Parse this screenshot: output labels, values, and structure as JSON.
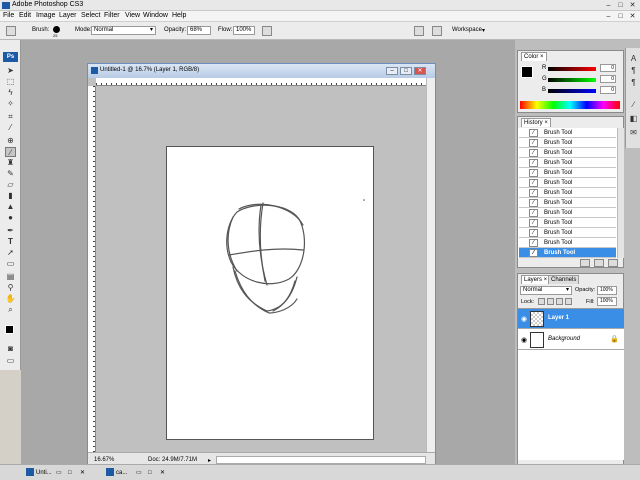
{
  "app": {
    "title": "Adobe Photoshop CS3"
  },
  "menu": [
    "File",
    "Edit",
    "Image",
    "Layer",
    "Select",
    "Filter",
    "View",
    "Window",
    "Help"
  ],
  "options": {
    "brush_label": "Brush:",
    "brush_size": "25",
    "mode_label": "Mode:",
    "mode_value": "Normal",
    "opacity_label": "Opacity:",
    "opacity_value": "68%",
    "flow_label": "Flow:",
    "flow_value": "100%",
    "workspace_label": "Workspace"
  },
  "document": {
    "title": "Untitled-1 @ 16.7% (Layer 1, RGB/8)",
    "zoom": "16.67%",
    "doc_info": "Doc: 24.9M/7.71M"
  },
  "color_panel": {
    "tab": "Color",
    "r": "0",
    "g": "0",
    "b": "0",
    "r_label": "R",
    "g_label": "G",
    "b_label": "B"
  },
  "history_panel": {
    "tab": "History",
    "items": [
      "Brush Tool",
      "Brush Tool",
      "Brush Tool",
      "Brush Tool",
      "Brush Tool",
      "Brush Tool",
      "Brush Tool",
      "Brush Tool",
      "Brush Tool",
      "Brush Tool",
      "Brush Tool",
      "Brush Tool",
      "Brush Tool"
    ],
    "selected_index": 12
  },
  "layers_panel": {
    "tabs": [
      "Layers",
      "Channels"
    ],
    "blend_mode": "Normal",
    "opacity_label": "Opacity:",
    "opacity_value": "100%",
    "lock_label": "Lock:",
    "fill_label": "Fill:",
    "fill_value": "100%",
    "layers": [
      {
        "name": "Layer 1",
        "selected": true
      },
      {
        "name": "Background",
        "selected": false
      }
    ]
  },
  "taskbar": [
    "Unti...",
    "ca..."
  ],
  "colors": {
    "accent": "#3a8ee6",
    "ps_blue": "#1c5aa6"
  }
}
